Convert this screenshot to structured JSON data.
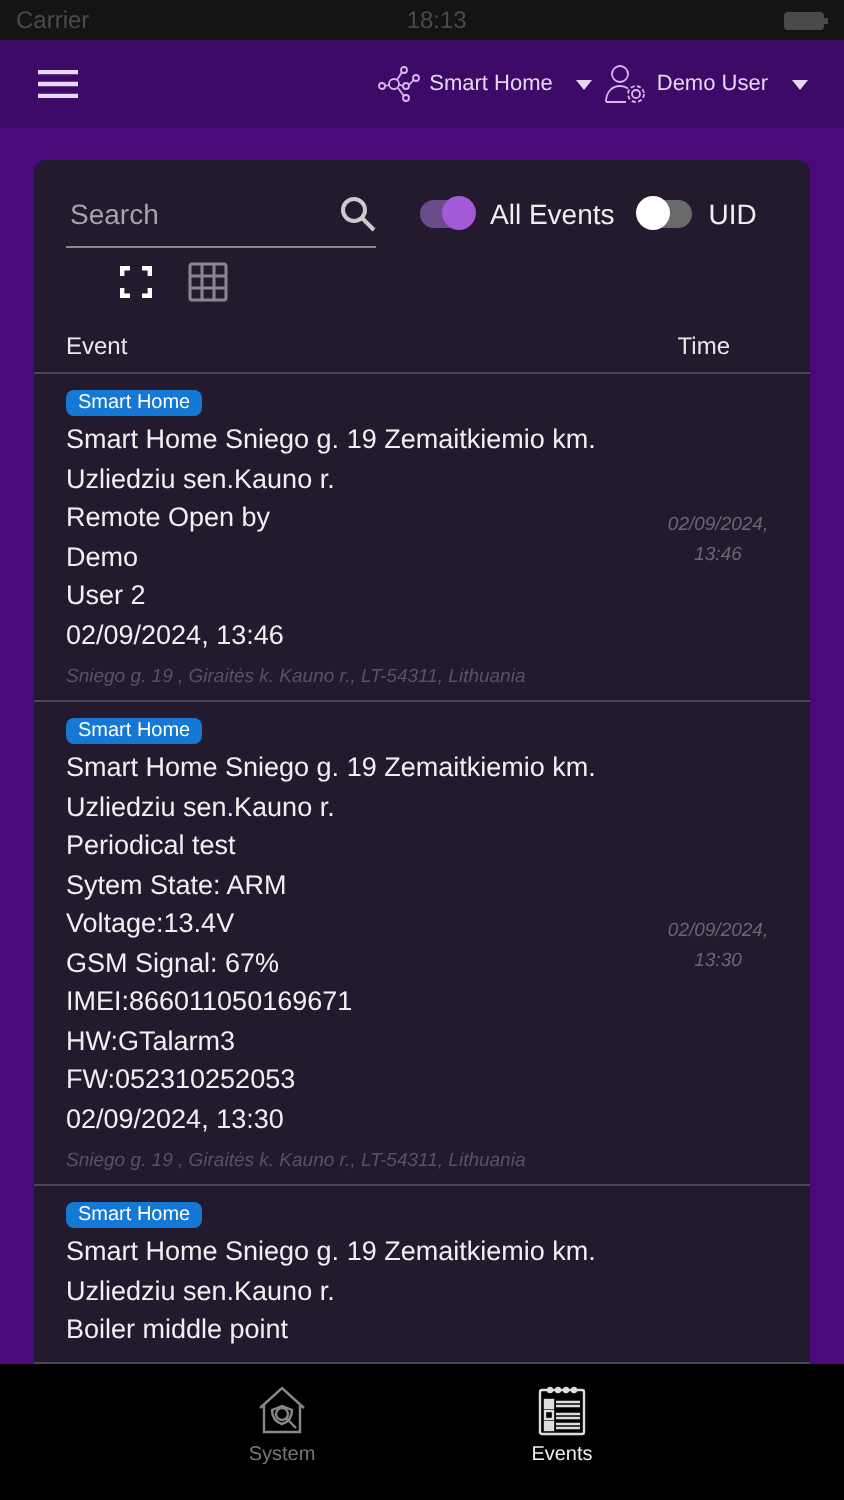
{
  "status_bar": {
    "carrier": "Carrier",
    "time": "18:13"
  },
  "header": {
    "site": "Smart Home",
    "user": "Demo User"
  },
  "search": {
    "placeholder": "Search"
  },
  "toggles": [
    {
      "label": "All Events",
      "on": true
    },
    {
      "label": "UID",
      "on": false
    }
  ],
  "view_buttons": [
    {
      "kind": "fullscreen",
      "selected": true
    },
    {
      "kind": "grid",
      "selected": false
    }
  ],
  "table": {
    "columns": [
      "Event",
      "Time"
    ],
    "rows": [
      {
        "tag": "Smart Home",
        "lines": [
          "Smart Home Sniego g. 19 Zemaitkiemio km.",
          "Uzliedziu sen.Kauno r.",
          "Remote Open by",
          "Demo",
          "User 2",
          "02/09/2024, 13:46"
        ],
        "time": "02/09/2024, 13:46",
        "address": "Sniego g. 19 , Giraitės k. Kauno r., LT-54311, Lithuania"
      },
      {
        "tag": "Smart Home",
        "lines": [
          "Smart Home Sniego g. 19 Zemaitkiemio km.",
          "Uzliedziu sen.Kauno r.",
          "Periodical test",
          "Sytem State: ARM",
          "Voltage:13.4V",
          "GSM Signal: 67%",
          "IMEI:866011050169671",
          "HW:GTalarm3",
          "FW:052310252053",
          "02/09/2024, 13:30"
        ],
        "time": "02/09/2024, 13:30",
        "address": "Sniego g. 19 , Giraitės k. Kauno r., LT-54311, Lithuania"
      },
      {
        "tag": "Smart Home",
        "lines": [
          "Smart Home Sniego g. 19 Zemaitkiemio km.",
          "Uzliedziu sen.Kauno r.",
          "Boiler middle point"
        ]
      }
    ]
  },
  "tab_bar": [
    {
      "kind": "system",
      "label": "System",
      "selected": false
    },
    {
      "kind": "events",
      "label": "Events",
      "selected": true
    }
  ]
}
